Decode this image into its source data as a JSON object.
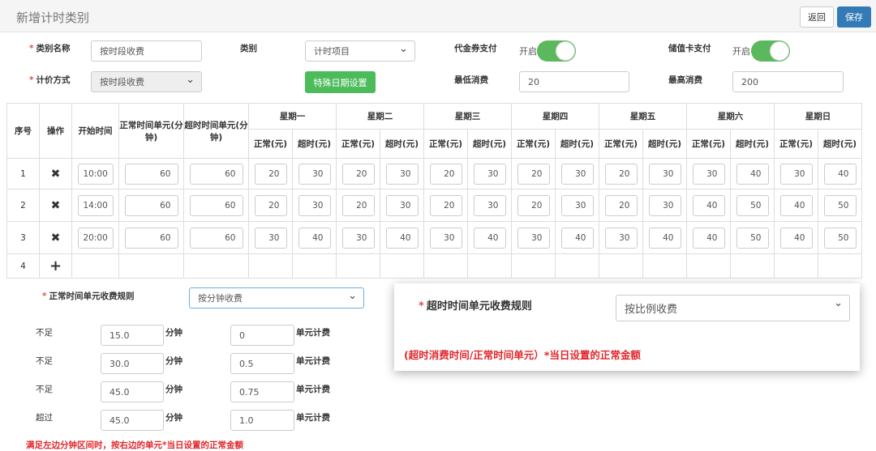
{
  "header": {
    "title": "新增计时类别",
    "back_label": "返回",
    "save_label": "保存"
  },
  "form": {
    "name_label": "类别名称",
    "name_value": "按时段收费",
    "category_label": "类别",
    "category_value": "计时项目",
    "voucher_label": "代金券支付",
    "voucher_state": "开启",
    "voucher_on": true,
    "card_label": "储值卡支付",
    "card_state": "开启",
    "card_on": true,
    "pricing_label": "计价方式",
    "pricing_value": "按时段收费",
    "special_button": "特殊日期设置",
    "min_label": "最低消费",
    "min_value": "20",
    "max_label": "最高消费",
    "max_value": "200"
  },
  "table": {
    "headers": {
      "index": "序号",
      "action": "操作",
      "start": "开始时间",
      "normal_unit": "正常时间单元(分钟)",
      "over_unit": "超时时间单元(分钟)",
      "normal": "正常(元)",
      "over": "超时(元)"
    },
    "days": [
      "星期一",
      "星期二",
      "星期三",
      "星期四",
      "星期五",
      "星期六",
      "星期日"
    ],
    "rows": [
      {
        "index": "1",
        "start": "10:00",
        "normal_unit": "60",
        "over_unit": "60",
        "prices": [
          [
            "20",
            "30"
          ],
          [
            "20",
            "30"
          ],
          [
            "20",
            "30"
          ],
          [
            "20",
            "30"
          ],
          [
            "20",
            "30"
          ],
          [
            "30",
            "40"
          ],
          [
            "30",
            "40"
          ]
        ]
      },
      {
        "index": "2",
        "start": "14:00",
        "normal_unit": "60",
        "over_unit": "60",
        "prices": [
          [
            "20",
            "30"
          ],
          [
            "20",
            "30"
          ],
          [
            "20",
            "30"
          ],
          [
            "20",
            "30"
          ],
          [
            "20",
            "30"
          ],
          [
            "40",
            "50"
          ],
          [
            "40",
            "50"
          ]
        ]
      },
      {
        "index": "3",
        "start": "20:00",
        "normal_unit": "60",
        "over_unit": "60",
        "prices": [
          [
            "30",
            "40"
          ],
          [
            "30",
            "40"
          ],
          [
            "30",
            "40"
          ],
          [
            "30",
            "40"
          ],
          [
            "30",
            "40"
          ],
          [
            "40",
            "50"
          ],
          [
            "40",
            "50"
          ]
        ]
      }
    ],
    "add_row_index": "4"
  },
  "normal_rule": {
    "label": "正常时间单元收费规则",
    "value": "按分钟收费",
    "rows": [
      {
        "prefix": "不足",
        "minutes": "15.0",
        "min_unit": "分钟",
        "factor": "0",
        "factor_unit": "单元计费"
      },
      {
        "prefix": "不足",
        "minutes": "30.0",
        "min_unit": "分钟",
        "factor": "0.5",
        "factor_unit": "单元计费"
      },
      {
        "prefix": "不足",
        "minutes": "45.0",
        "min_unit": "分钟",
        "factor": "0.75",
        "factor_unit": "单元计费"
      },
      {
        "prefix": "超过",
        "minutes": "45.0",
        "min_unit": "分钟",
        "factor": "1.0",
        "factor_unit": "单元计费"
      }
    ],
    "note": "满足左边分钟区间时，按右边的单元*当日设置的正常金额"
  },
  "over_rule": {
    "label": "超时时间单元收费规则",
    "value": "按比例收费",
    "formula": "(超时消费时间/正常时间单元）*当日设置的正常金额"
  }
}
